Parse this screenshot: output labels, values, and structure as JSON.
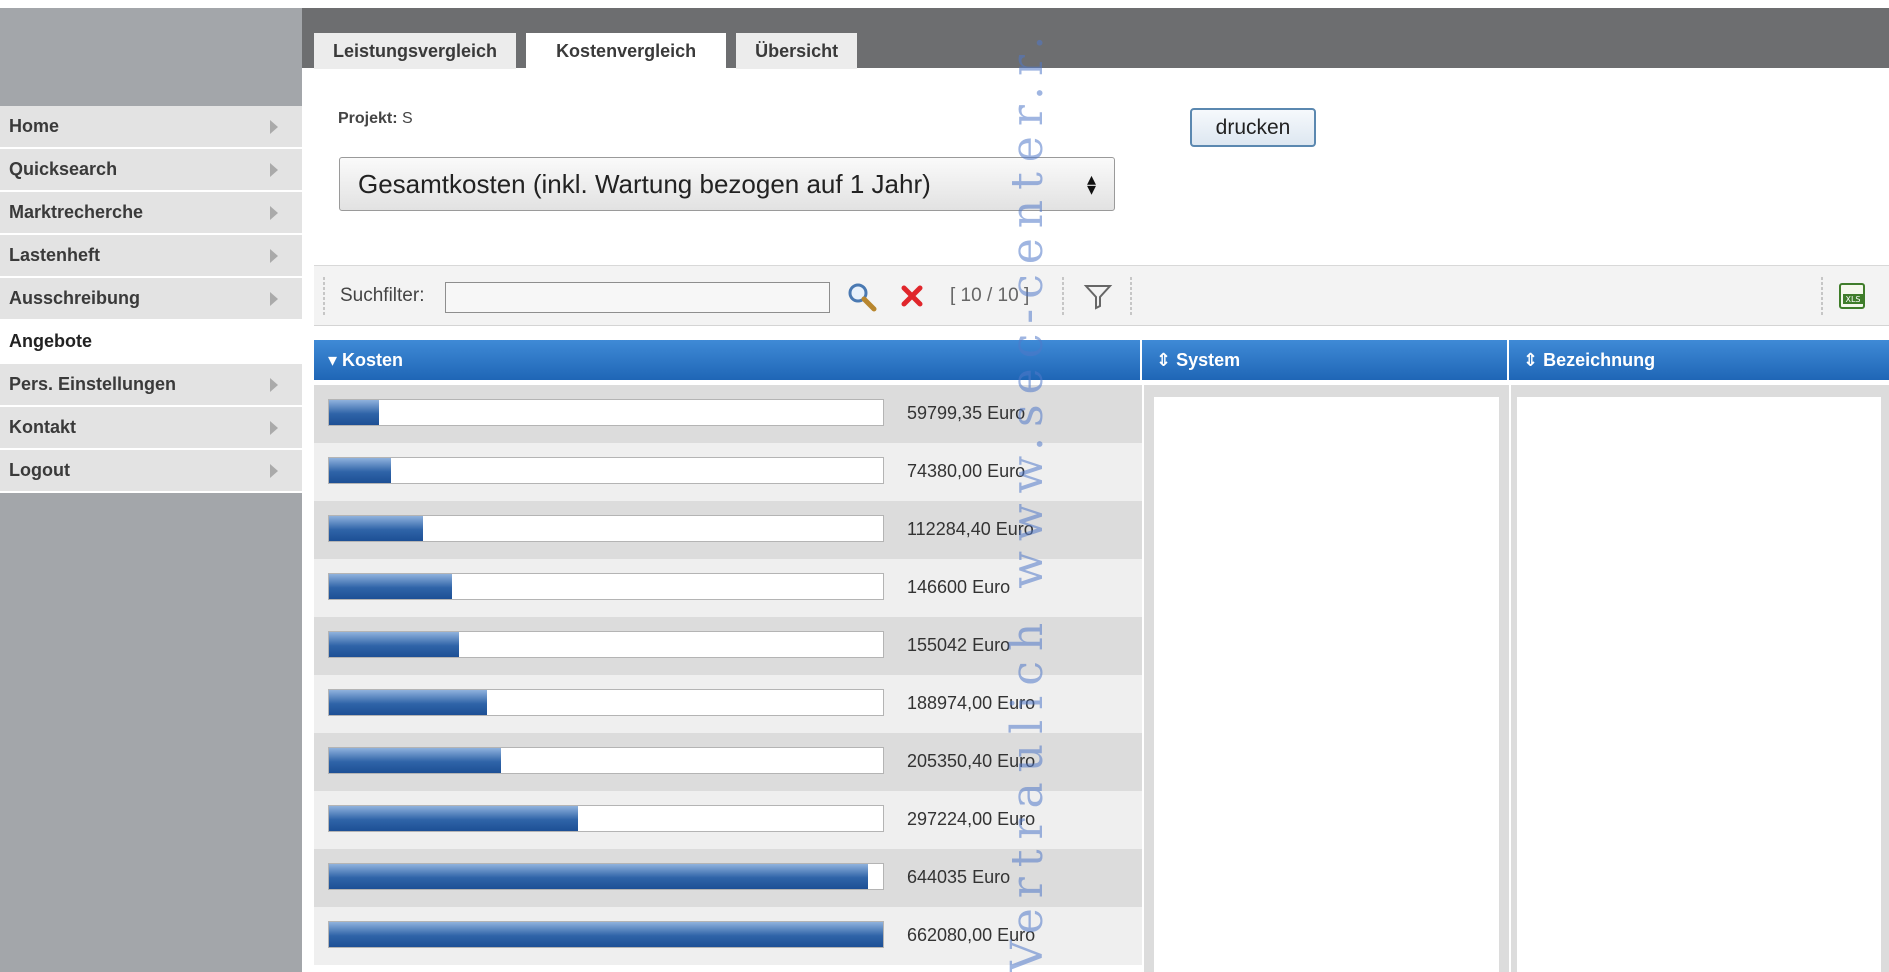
{
  "tabs": [
    {
      "label": "Leistungsvergleich"
    },
    {
      "label": "Kostenvergleich"
    },
    {
      "label": "Übersicht"
    }
  ],
  "sidebar": {
    "items": [
      {
        "label": "Home"
      },
      {
        "label": "Quicksearch"
      },
      {
        "label": "Marktrecherche"
      },
      {
        "label": "Lastenheft"
      },
      {
        "label": "Ausschreibung"
      },
      {
        "label": "Angebote"
      },
      {
        "label": "Pers. Einstellungen"
      },
      {
        "label": "Kontakt"
      },
      {
        "label": "Logout"
      }
    ],
    "active": "Angebote"
  },
  "header": {
    "projekt_label": "Projekt:",
    "projekt_value": "S",
    "print_button": "drucken",
    "cost_select": "Gesamtkosten (inkl. Wartung bezogen auf 1 Jahr)"
  },
  "toolbar": {
    "filter_label": "Suchfilter:",
    "filter_value": "",
    "record_count": "[ 10 / 10 ]"
  },
  "grid": {
    "columns": [
      {
        "label": "Kosten",
        "sort_icon": "sort-desc-icon"
      },
      {
        "label": "System",
        "sort_icon": "sort-icon"
      },
      {
        "label": "Bezeichnung",
        "sort_icon": "sort-icon"
      }
    ],
    "rows": [
      {
        "cost": "59799,35 Euro",
        "value": 59799.35
      },
      {
        "cost": "74380,00 Euro",
        "value": 74380.0
      },
      {
        "cost": "112284,40 Euro",
        "value": 112284.4
      },
      {
        "cost": "146600 Euro",
        "value": 146600
      },
      {
        "cost": "155042 Euro",
        "value": 155042
      },
      {
        "cost": "188974,00 Euro",
        "value": 188974.0
      },
      {
        "cost": "205350,40 Euro",
        "value": 205350.4
      },
      {
        "cost": "297224,00 Euro",
        "value": 297224.0
      },
      {
        "cost": "644035 Euro",
        "value": 644035
      },
      {
        "cost": "662080,00 Euro",
        "value": 662080.0
      }
    ],
    "bar_max": 662080.0
  },
  "watermark": "Vertraulich www.sec-center.r.",
  "colors": {
    "header_blue": "#2f78c8",
    "bar_blue": "#2f64a8",
    "sidebar_bg": "#a3a6aa",
    "topbar_bg": "#6d6e70"
  }
}
